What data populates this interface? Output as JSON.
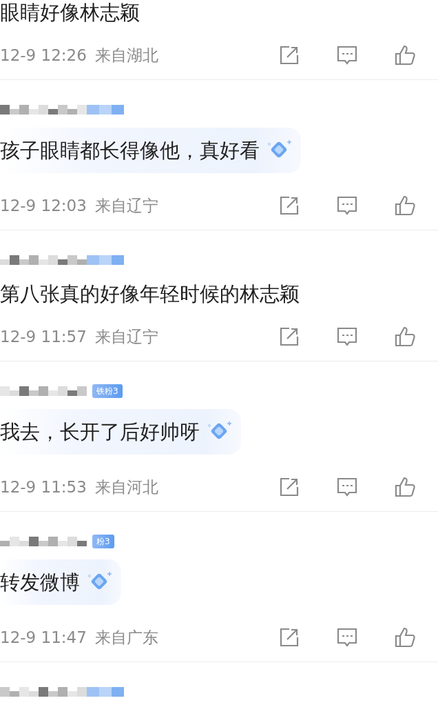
{
  "comments": [
    {
      "kind": "top_cut",
      "text": "眼睛好像林志颖",
      "time": "12-9 12:26",
      "location": "来自湖北"
    },
    {
      "kind": "full",
      "bubble": true,
      "text": "孩子眼睛都长得像他，真好看",
      "time": "12-9 12:03",
      "location": "来自辽宁"
    },
    {
      "kind": "full",
      "text": "第八张真的好像年轻时候的林志颖",
      "time": "12-9 11:57",
      "location": "来自辽宁"
    },
    {
      "kind": "full",
      "badge": "铁粉3",
      "bubble": true,
      "text": "我去，长开了后好帅呀",
      "time": "12-9 11:53",
      "location": "来自河北"
    },
    {
      "kind": "full",
      "badge": "粉3",
      "bubble": true,
      "text": "转发微博",
      "time": "12-9 11:47",
      "location": "来自广东"
    },
    {
      "kind": "full"
    }
  ]
}
